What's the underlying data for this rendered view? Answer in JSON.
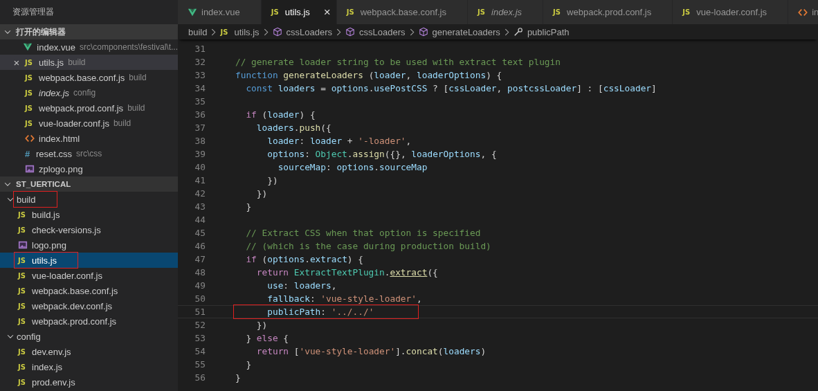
{
  "sidebar": {
    "title": "资源管理器",
    "sections": [
      {
        "label": "打开的编辑器",
        "expanded": true,
        "kind": "open_editors",
        "items": [
          {
            "kind": "vue",
            "name": "index.vue",
            "description": "src\\components\\festival\\t...",
            "italic": false,
            "selected": false
          },
          {
            "kind": "js",
            "badge": "JS",
            "name": "utils.js",
            "description": "build",
            "italic": false,
            "selected": true,
            "close": "×"
          },
          {
            "kind": "js",
            "badge": "JS",
            "name": "webpack.base.conf.js",
            "description": "build",
            "italic": false,
            "selected": false
          },
          {
            "kind": "js",
            "badge": "JS",
            "name": "index.js",
            "description": "config",
            "italic": true,
            "selected": false
          },
          {
            "kind": "js",
            "badge": "JS",
            "name": "webpack.prod.conf.js",
            "description": "build",
            "italic": false,
            "selected": false
          },
          {
            "kind": "js",
            "badge": "JS",
            "name": "vue-loader.conf.js",
            "description": "build",
            "italic": false,
            "selected": false
          },
          {
            "kind": "html",
            "name": "index.html",
            "italic": false,
            "selected": false
          },
          {
            "kind": "css",
            "badge": "#",
            "name": "reset.css",
            "description": "src\\css",
            "italic": false,
            "selected": false
          },
          {
            "kind": "image",
            "name": "zplogo.png",
            "italic": false,
            "selected": false
          }
        ]
      },
      {
        "label": "ST_UERTICAL",
        "expanded": true,
        "kind": "folders",
        "items": [
          {
            "kind": "folder",
            "name": "build",
            "expanded": true,
            "selected": false,
            "annotated": true,
            "children": [
              {
                "kind": "js",
                "badge": "JS",
                "name": "build.js",
                "selected": false,
                "annotated": false
              },
              {
                "kind": "js",
                "badge": "JS",
                "name": "check-versions.js",
                "selected": false,
                "annotated": false
              },
              {
                "kind": "image",
                "name": "logo.png",
                "selected": false,
                "annotated": false
              },
              {
                "kind": "js",
                "badge": "JS",
                "name": "utils.js",
                "selected": true,
                "annotated": true
              },
              {
                "kind": "js",
                "badge": "JS",
                "name": "vue-loader.conf.js",
                "selected": false,
                "annotated": false
              },
              {
                "kind": "js",
                "badge": "JS",
                "name": "webpack.base.conf.js",
                "selected": false,
                "annotated": false
              },
              {
                "kind": "js",
                "badge": "JS",
                "name": "webpack.dev.conf.js",
                "selected": false,
                "annotated": false
              },
              {
                "kind": "js",
                "badge": "JS",
                "name": "webpack.prod.conf.js",
                "selected": false,
                "annotated": false
              }
            ]
          },
          {
            "kind": "folder",
            "name": "config",
            "expanded": true,
            "selected": false,
            "annotated": false,
            "children": [
              {
                "kind": "js",
                "badge": "JS",
                "name": "dev.env.js",
                "selected": false,
                "annotated": false
              },
              {
                "kind": "js",
                "badge": "JS",
                "name": "index.js",
                "selected": false,
                "annotated": false
              },
              {
                "kind": "js",
                "badge": "JS",
                "name": "prod.env.js",
                "selected": false,
                "annotated": false
              }
            ]
          }
        ]
      }
    ]
  },
  "tabs": [
    {
      "kind": "vue",
      "label": "index.vue",
      "italic": false,
      "selected": false
    },
    {
      "kind": "js",
      "badge": "JS",
      "label": "utils.js",
      "italic": false,
      "selected": true,
      "close": "×"
    },
    {
      "kind": "js",
      "badge": "JS",
      "label": "webpack.base.conf.js",
      "italic": false,
      "selected": false
    },
    {
      "kind": "js",
      "badge": "JS",
      "label": "index.js",
      "italic": true,
      "selected": false
    },
    {
      "kind": "js",
      "badge": "JS",
      "label": "webpack.prod.conf.js",
      "italic": false,
      "selected": false
    },
    {
      "kind": "js",
      "badge": "JS",
      "label": "vue-loader.conf.js",
      "italic": false,
      "selected": false
    },
    {
      "kind": "html",
      "label": "in",
      "selected": false
    }
  ],
  "breadcrumbs": [
    {
      "kind": "folder",
      "label": "build"
    },
    {
      "kind": "js",
      "badge": "JS",
      "label": "utils.js"
    },
    {
      "kind": "module",
      "label": "cssLoaders"
    },
    {
      "kind": "module",
      "label": "cssLoaders"
    },
    {
      "kind": "module",
      "label": "generateLoaders"
    },
    {
      "kind": "property",
      "label": "publicPath"
    }
  ],
  "editor": {
    "lines": [
      {
        "number": "31",
        "current": false
      },
      {
        "number": "32",
        "current": false,
        "annotated": false,
        "tokens": [
          {
            "kind": "cmt",
            "t": "// generate loader string to be used with extract text plugin"
          }
        ]
      },
      {
        "number": "33",
        "current": false,
        "annotated": false,
        "tokens": [
          {
            "kind": "kw",
            "t": "function"
          },
          {
            "kind": "fn",
            "t": " generateLoaders"
          },
          {
            "kind": "p",
            "t": " ("
          },
          {
            "kind": "var",
            "t": "loader"
          },
          {
            "kind": "p",
            "t": ", "
          },
          {
            "kind": "var",
            "t": "loaderOptions"
          },
          {
            "kind": "p",
            "t": ") {"
          }
        ]
      },
      {
        "number": "34",
        "current": false,
        "annotated": false,
        "tokens": [
          {
            "kind": "kw",
            "t": "  const"
          },
          {
            "kind": "var",
            "t": " loaders"
          },
          {
            "kind": "p",
            "t": " = "
          },
          {
            "kind": "var",
            "t": "options"
          },
          {
            "kind": "p",
            "t": "."
          },
          {
            "kind": "var",
            "t": "usePostCSS"
          },
          {
            "kind": "p",
            "t": " ? ["
          },
          {
            "kind": "var",
            "t": "cssLoader"
          },
          {
            "kind": "p",
            "t": ", "
          },
          {
            "kind": "var",
            "t": "postcssLoader"
          },
          {
            "kind": "p",
            "t": "] : ["
          },
          {
            "kind": "var",
            "t": "cssLoader"
          },
          {
            "kind": "p",
            "t": "]"
          }
        ]
      },
      {
        "number": "35",
        "current": false
      },
      {
        "number": "36",
        "current": false,
        "annotated": false,
        "tokens": [
          {
            "kind": "ctl",
            "t": "  if"
          },
          {
            "kind": "p",
            "t": " ("
          },
          {
            "kind": "var",
            "t": "loader"
          },
          {
            "kind": "p",
            "t": ") {"
          }
        ]
      },
      {
        "number": "37",
        "current": false,
        "annotated": false,
        "tokens": [
          {
            "kind": "var",
            "t": "    loaders"
          },
          {
            "kind": "p",
            "t": "."
          },
          {
            "kind": "fn",
            "t": "push"
          },
          {
            "kind": "p",
            "t": "({"
          }
        ]
      },
      {
        "number": "38",
        "current": false,
        "annotated": false,
        "tokens": [
          {
            "kind": "var",
            "t": "      loader"
          },
          {
            "kind": "p",
            "t": ": "
          },
          {
            "kind": "var",
            "t": "loader"
          },
          {
            "kind": "p",
            "t": " + "
          },
          {
            "kind": "str",
            "t": "'-loader'"
          },
          {
            "kind": "p",
            "t": ","
          }
        ]
      },
      {
        "number": "39",
        "current": false,
        "annotated": false,
        "tokens": [
          {
            "kind": "var",
            "t": "      options"
          },
          {
            "kind": "p",
            "t": ": "
          },
          {
            "kind": "cls",
            "t": "Object"
          },
          {
            "kind": "p",
            "t": "."
          },
          {
            "kind": "fn",
            "t": "assign"
          },
          {
            "kind": "p",
            "t": "({}, "
          },
          {
            "kind": "var",
            "t": "loaderOptions"
          },
          {
            "kind": "p",
            "t": ", {"
          }
        ]
      },
      {
        "number": "40",
        "current": false,
        "annotated": false,
        "tokens": [
          {
            "kind": "var",
            "t": "        sourceMap"
          },
          {
            "kind": "p",
            "t": ": "
          },
          {
            "kind": "var",
            "t": "options"
          },
          {
            "kind": "p",
            "t": "."
          },
          {
            "kind": "var",
            "t": "sourceMap"
          }
        ]
      },
      {
        "number": "41",
        "current": false,
        "annotated": false,
        "tokens": [
          {
            "kind": "p",
            "t": "      })"
          }
        ]
      },
      {
        "number": "42",
        "current": false,
        "annotated": false,
        "tokens": [
          {
            "kind": "p",
            "t": "    })"
          }
        ]
      },
      {
        "number": "43",
        "current": false,
        "annotated": false,
        "tokens": [
          {
            "kind": "p",
            "t": "  }"
          }
        ]
      },
      {
        "number": "44",
        "current": false
      },
      {
        "number": "45",
        "current": false,
        "annotated": false,
        "tokens": [
          {
            "kind": "cmt",
            "t": "  // Extract CSS when that option is specified"
          }
        ]
      },
      {
        "number": "46",
        "current": false,
        "annotated": false,
        "tokens": [
          {
            "kind": "cmt",
            "t": "  // (which is the case during production build)"
          }
        ]
      },
      {
        "number": "47",
        "current": false,
        "annotated": false,
        "tokens": [
          {
            "kind": "ctl",
            "t": "  if"
          },
          {
            "kind": "p",
            "t": " ("
          },
          {
            "kind": "var",
            "t": "options"
          },
          {
            "kind": "p",
            "t": "."
          },
          {
            "kind": "var",
            "t": "extract"
          },
          {
            "kind": "p",
            "t": ") {"
          }
        ]
      },
      {
        "number": "48",
        "current": false,
        "annotated": false,
        "tokens": [
          {
            "kind": "ctl",
            "t": "    return"
          },
          {
            "kind": "cls",
            "t": " ExtractTextPlugin"
          },
          {
            "kind": "p",
            "t": "."
          },
          {
            "kind": "link",
            "t": "extract"
          },
          {
            "kind": "p",
            "t": "({"
          }
        ]
      },
      {
        "number": "49",
        "current": false,
        "annotated": false,
        "tokens": [
          {
            "kind": "var",
            "t": "      use"
          },
          {
            "kind": "p",
            "t": ": "
          },
          {
            "kind": "var",
            "t": "loaders"
          },
          {
            "kind": "p",
            "t": ","
          }
        ]
      },
      {
        "number": "50",
        "current": false,
        "annotated": false,
        "tokens": [
          {
            "kind": "var",
            "t": "      fallback"
          },
          {
            "kind": "p",
            "t": ": "
          },
          {
            "kind": "str",
            "t": "'vue-style-loader'"
          },
          {
            "kind": "p",
            "t": ","
          }
        ]
      },
      {
        "number": "51",
        "current": true,
        "annotated": true,
        "tokens": [
          {
            "kind": "var",
            "t": "      publicPath"
          },
          {
            "kind": "p",
            "t": ": "
          },
          {
            "kind": "str",
            "t": "'../../'"
          }
        ]
      },
      {
        "number": "52",
        "current": false,
        "annotated": false,
        "tokens": [
          {
            "kind": "p",
            "t": "    })"
          }
        ]
      },
      {
        "number": "53",
        "current": false,
        "annotated": false,
        "tokens": [
          {
            "kind": "p",
            "t": "  }"
          },
          {
            "kind": "ctl",
            "t": " else"
          },
          {
            "kind": "p",
            "t": " {"
          }
        ]
      },
      {
        "number": "54",
        "current": false,
        "annotated": false,
        "tokens": [
          {
            "kind": "ctl",
            "t": "    return"
          },
          {
            "kind": "p",
            "t": " ["
          },
          {
            "kind": "str",
            "t": "'vue-style-loader'"
          },
          {
            "kind": "p",
            "t": "]."
          },
          {
            "kind": "fn",
            "t": "concat"
          },
          {
            "kind": "p",
            "t": "("
          },
          {
            "kind": "var",
            "t": "loaders"
          },
          {
            "kind": "p",
            "t": ")"
          }
        ]
      },
      {
        "number": "55",
        "current": false,
        "annotated": false,
        "tokens": [
          {
            "kind": "p",
            "t": "  }"
          }
        ]
      },
      {
        "number": "56",
        "current": false,
        "annotated": false,
        "tokens": [
          {
            "kind": "p",
            "t": "}"
          }
        ]
      }
    ]
  }
}
